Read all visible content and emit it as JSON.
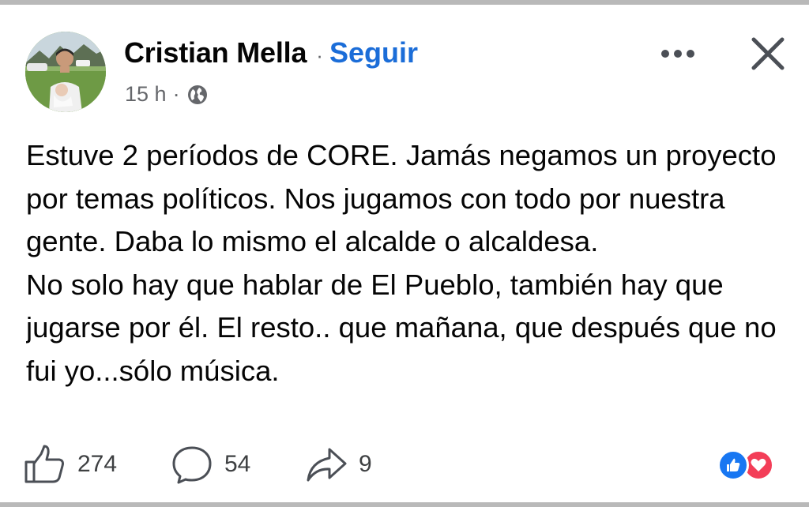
{
  "post": {
    "author": "Cristian Mella",
    "separator": "·",
    "follow_label": "Seguir",
    "time": "15 h",
    "time_separator": "·",
    "audience_icon": "globe-icon",
    "body_lines": [
      "Estuve 2 períodos de CORE. Jamás negamos un proyecto por temas políticos. Nos jugamos con todo por nuestra gente. Daba lo mismo el alcalde o alcaldesa.",
      "No solo hay que hablar de El Pueblo, también hay que jugarse por él. El resto..  que mañana, que después que no fui yo...sólo  música."
    ]
  },
  "actions": {
    "like": {
      "icon": "thumbs-up-icon",
      "count": "274"
    },
    "comment": {
      "icon": "comment-bubble-icon",
      "count": "54"
    },
    "share": {
      "icon": "share-arrow-icon",
      "count": "9"
    }
  },
  "reactions": [
    "like-reaction-icon",
    "love-reaction-icon"
  ],
  "colors": {
    "follow_blue": "#1b6dd8",
    "like_blue": "#1877f2",
    "love_red": "#f33e58",
    "secondary_text": "#65676b"
  }
}
